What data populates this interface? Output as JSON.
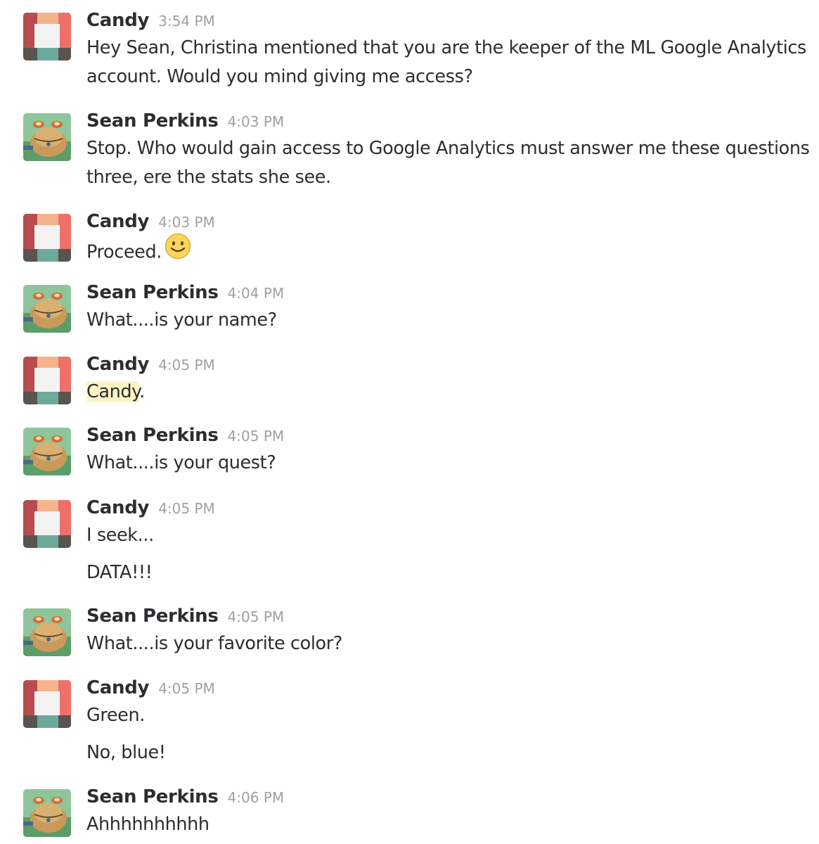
{
  "messages": [
    {
      "sender": "Candy",
      "time": "3:54 PM",
      "lines": [
        "Hey Sean, Christina mentioned that you are the keeper of the ML Google Analytics",
        "account.  Would you mind giving me access?"
      ]
    },
    {
      "sender": "Sean Perkins",
      "time": "4:03 PM",
      "lines": [
        "Stop. Who would gain access to Google Analytics must answer me these questions",
        "three, ere the stats she see."
      ]
    },
    {
      "sender": "Candy",
      "time": "4:03 PM",
      "lines": [
        "Proceed."
      ],
      "emoji": "slightly-smiling-face-icon"
    },
    {
      "sender": "Sean Perkins",
      "time": "4:04 PM",
      "lines": [
        "What....is your name?"
      ]
    },
    {
      "sender": "Candy",
      "time": "4:05 PM",
      "highlight": "Candy",
      "after_highlight": "."
    },
    {
      "sender": "Sean Perkins",
      "time": "4:05 PM",
      "lines": [
        "What....is your quest?"
      ]
    },
    {
      "sender": "Candy",
      "time": "4:05 PM",
      "lines": [
        "I seek..."
      ],
      "followup": "DATA!!!"
    },
    {
      "sender": "Sean Perkins",
      "time": "4:05 PM",
      "lines": [
        "What....is your favorite color?"
      ]
    },
    {
      "sender": "Candy",
      "time": "4:05 PM",
      "lines": [
        "Green."
      ],
      "followup": "No, blue!"
    },
    {
      "sender": "Sean Perkins",
      "time": "4:06 PM",
      "lines": [
        "Ahhhhhhhhhh"
      ]
    }
  ],
  "avatars": {
    "candy": "candy-avatar-icon",
    "sean": "frog-avatar-icon"
  },
  "colors": {
    "text": "#2c2d30",
    "timestamp": "#a0a0a2",
    "highlight": "#fdf4c6"
  }
}
